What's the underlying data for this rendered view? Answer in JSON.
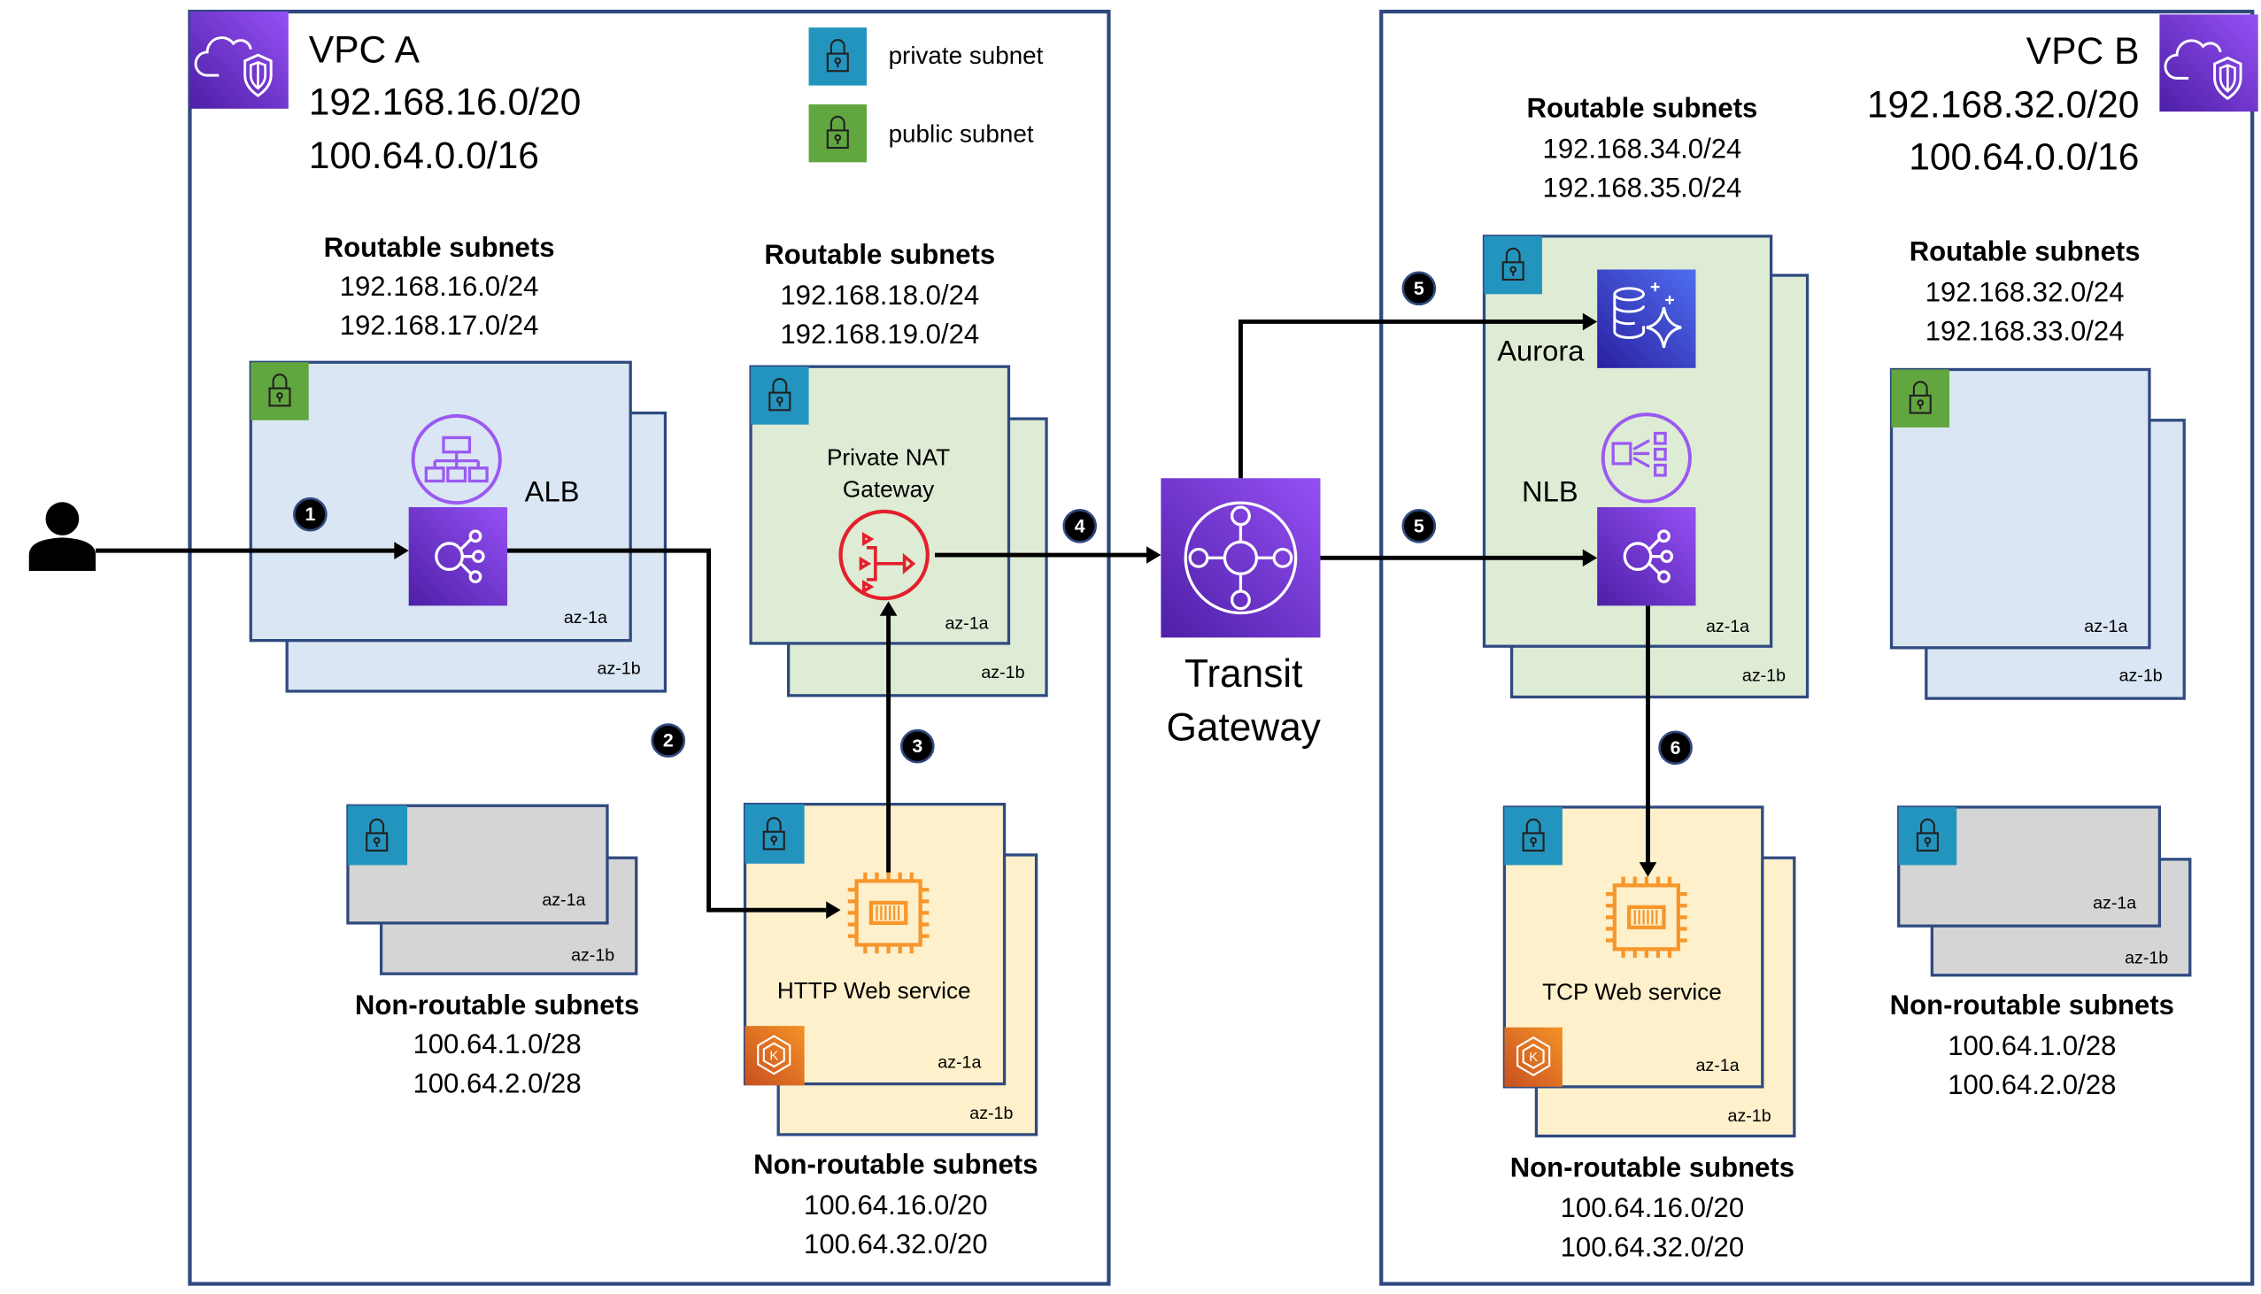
{
  "legend": {
    "private": "private subnet",
    "public": "public subnet"
  },
  "colors": {
    "vpc_border": "#2f4a80",
    "private_subnet": "#2394be",
    "public_subnet": "#62a63f",
    "aws_purple": "#7b3de8",
    "nat_red": "#e3202c",
    "compute_orange": "#f7962b",
    "eks_orange": "#e06b24"
  },
  "vpc_a": {
    "title": "VPC A",
    "cidrs": [
      "192.168.16.0/20",
      "100.64.0.0/16"
    ],
    "public_routable": {
      "heading": "Routable subnets",
      "cidrs": [
        "192.168.16.0/24",
        "192.168.17.0/24"
      ],
      "service": "ALB",
      "az_front": "az-1a",
      "az_back": "az-1b"
    },
    "private_routable": {
      "heading": "Routable subnets",
      "cidrs": [
        "192.168.18.0/24",
        "192.168.19.0/24"
      ],
      "service_line1": "Private NAT",
      "service_line2": "Gateway",
      "az_front": "az-1a",
      "az_back": "az-1b"
    },
    "nonroutable_empty": {
      "heading": "Non-routable subnets",
      "cidrs": [
        "100.64.1.0/28",
        "100.64.2.0/28"
      ],
      "az_front": "az-1a",
      "az_back": "az-1b"
    },
    "nonroutable_service": {
      "heading": "Non-routable subnets",
      "cidrs": [
        "100.64.16.0/20",
        "100.64.32.0/20"
      ],
      "service": "HTTP Web service",
      "az_front": "az-1a",
      "az_back": "az-1b"
    }
  },
  "transit_gateway": {
    "line1": "Transit",
    "line2": "Gateway"
  },
  "vpc_b": {
    "title": "VPC B",
    "cidrs": [
      "192.168.32.0/20",
      "100.64.0.0/16"
    ],
    "private_routable": {
      "heading": "Routable subnets",
      "cidrs": [
        "192.168.34.0/24",
        "192.168.35.0/24"
      ],
      "service_db": "Aurora",
      "service_lb": "NLB",
      "az_front": "az-1a",
      "az_back": "az-1b"
    },
    "public_routable": {
      "heading": "Routable subnets",
      "cidrs": [
        "192.168.32.0/24",
        "192.168.33.0/24"
      ],
      "az_front": "az-1a",
      "az_back": "az-1b"
    },
    "nonroutable_service": {
      "heading": "Non-routable subnets",
      "cidrs": [
        "100.64.16.0/20",
        "100.64.32.0/20"
      ],
      "service": "TCP Web service",
      "az_front": "az-1a",
      "az_back": "az-1b"
    },
    "nonroutable_empty": {
      "heading": "Non-routable subnets",
      "cidrs": [
        "100.64.1.0/28",
        "100.64.2.0/28"
      ],
      "az_front": "az-1a",
      "az_back": "az-1b"
    }
  },
  "steps": [
    "1",
    "2",
    "3",
    "4",
    "5",
    "5",
    "6"
  ]
}
